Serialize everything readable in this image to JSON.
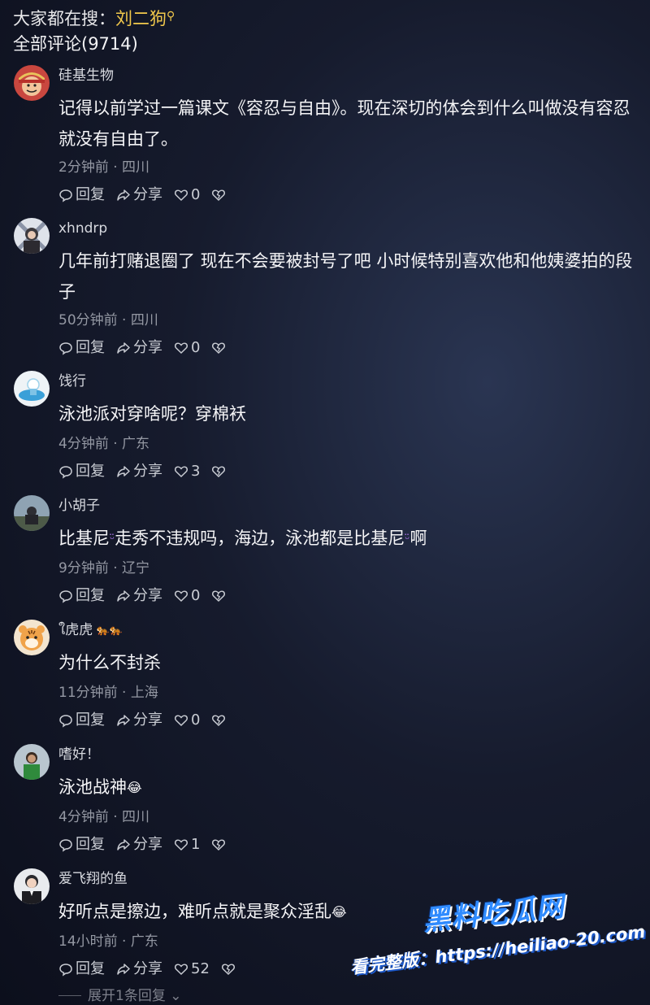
{
  "search": {
    "prefix": "大家都在搜：",
    "keyword": "刘二狗"
  },
  "comments_header": "全部评论(9714)",
  "actions": {
    "reply": "回复",
    "share": "分享"
  },
  "comments": [
    {
      "username": "硅基生物",
      "text": "记得以前学过一篇课文《容忍与自由》。现在深切的体会到什么叫做没有容忍就没有自由了。",
      "time": "2分钟前",
      "location": "四川",
      "likes": "0"
    },
    {
      "username": "xhndrp",
      "text": "几年前打赌退圈了 现在不会要被封号了吧 小时候特别喜欢他和他姨婆拍的段子",
      "time": "50分钟前",
      "location": "四川",
      "likes": "0"
    },
    {
      "username": "饯行",
      "text": "泳池派对穿啥呢？穿棉袄",
      "time": "4分钟前",
      "location": "广东",
      "likes": "3"
    },
    {
      "username": "小胡子",
      "text_a": "比基尼",
      "text_b": "走秀不违规吗，海边，泳池都是比基尼",
      "text_c": "啊",
      "time": "9分钟前",
      "location": "辽宁",
      "likes": "0"
    },
    {
      "username": "ใ虎虎",
      "text": "为什么不封杀",
      "time": "11分钟前",
      "location": "上海",
      "likes": "0"
    },
    {
      "username": "嗜好！",
      "text": "泳池战神",
      "time": "4分钟前",
      "location": "四川",
      "likes": "1"
    },
    {
      "username": "爱飞翔的鱼",
      "text": "好听点是擦边，难听点就是聚众淫乱",
      "time": "14小时前",
      "location": "广东",
      "likes": "52"
    }
  ],
  "expand_replies": "展开1条回复",
  "watermark": {
    "logo": "黑料吃瓜网",
    "url": "看完整版：https://heiliao-20.com"
  },
  "icons": [
    "search-icon",
    "reply-icon",
    "share-icon",
    "heart-icon",
    "dislike-icon",
    "chevron-down-icon",
    "laugh-emoji",
    "bikini-emoji",
    "tiger-emoji"
  ],
  "colors": {
    "keyword": "#f2c94c",
    "meta": "#9498a3",
    "watermark_blue": "#2f8bff"
  }
}
